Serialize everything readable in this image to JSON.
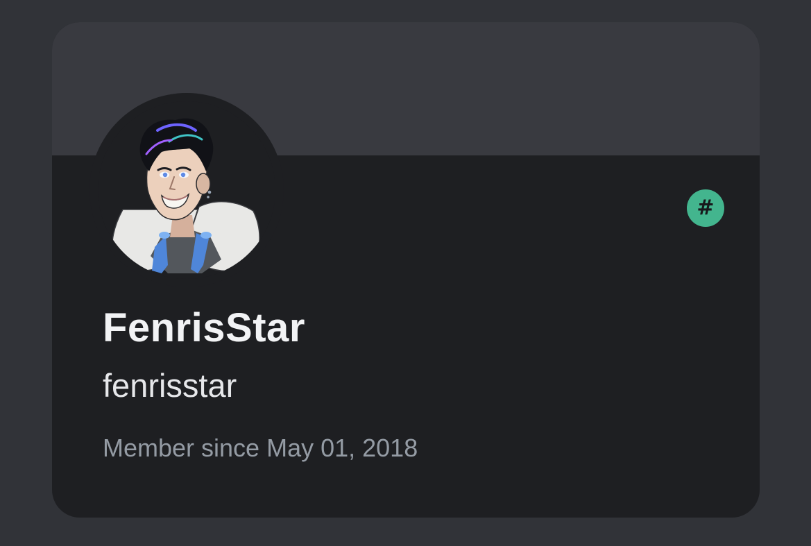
{
  "profile": {
    "display_name": "FenrisStar",
    "username": "fenrisstar",
    "member_since": "Member since May 01, 2018",
    "badge_symbol": "#",
    "avatar_icon": "anime-character-avatar"
  },
  "colors": {
    "page_background": "#313338",
    "card_background": "#1e1f22",
    "banner": "#393a40",
    "badge": "#43b58e",
    "display_name": "#f2f3f5",
    "username": "#e6e7ea",
    "member_since": "#949ba4"
  }
}
